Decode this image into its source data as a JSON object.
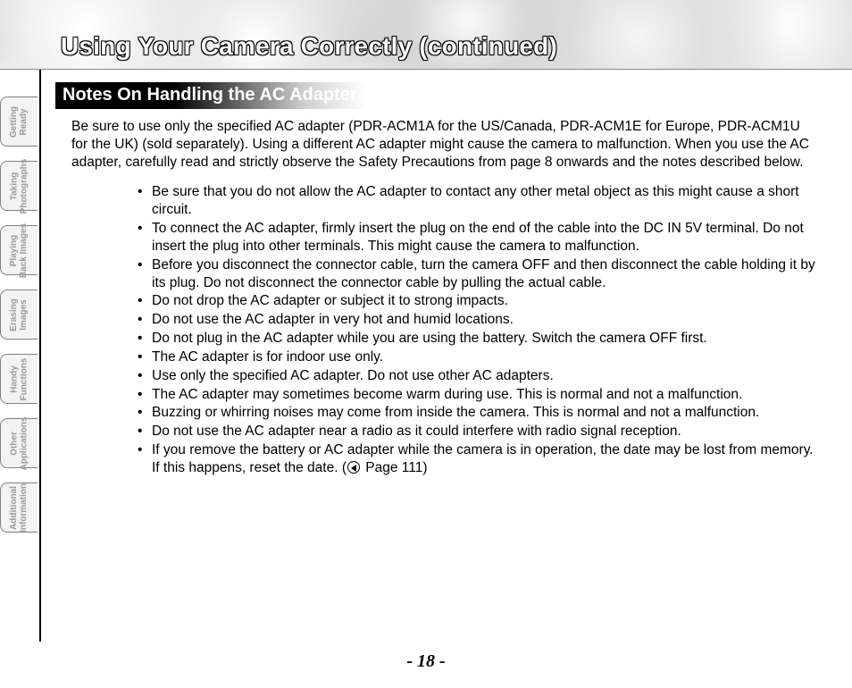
{
  "header": {
    "title": "Using Your Camera Correctly (continued)"
  },
  "sidebar": {
    "tabs": [
      {
        "label": "Getting\nReady"
      },
      {
        "label": "Taking\nPhotographs"
      },
      {
        "label": "Playing\nBack Images"
      },
      {
        "label": "Erasing\nImages"
      },
      {
        "label": "Handy\nFunctions"
      },
      {
        "label": "Other\nApplications"
      },
      {
        "label": "Additional\nInformation"
      }
    ]
  },
  "section": {
    "heading": "Notes On Handling the AC Adapter",
    "intro": "Be sure to use only the specified AC adapter (PDR-ACM1A for the US/Canada, PDR-ACM1E for Europe, PDR-ACM1U for the UK) (sold separately). Using a different AC adapter might cause the camera to malfunction. When you use the AC adapter, carefully read and strictly observe the Safety Precautions from page 8 onwards and the notes described below.",
    "bullets": [
      "Be sure that you do not allow the AC adapter to contact any other metal object as this might cause a short circuit.",
      "To connect the AC adapter, firmly insert the plug on the end of the cable into the DC IN 5V terminal. Do not insert the plug into other terminals. This might cause the camera to malfunction.",
      "Before you disconnect the connector cable, turn the camera OFF and then disconnect the cable holding it by its plug. Do not disconnect the connector cable by pulling the actual cable.",
      "Do not drop the AC adapter or subject it to strong impacts.",
      "Do not use the AC adapter in very hot and humid locations.",
      "Do not plug in the AC adapter while you are using the battery. Switch the camera OFF first.",
      "The AC adapter is for indoor use only.",
      "Use only the specified AC adapter. Do not use other AC adapters.",
      "The AC adapter may sometimes become warm during use. This is normal and not a malfunction.",
      "Buzzing or whirring noises may come from inside the camera. This is normal and not a malfunction.",
      "Do not use the AC adapter near a radio as it could interfere with radio signal reception."
    ],
    "bullet_last_before": "If you remove the battery or AC adapter while the camera is in operation, the date may be lost from memory. If this happens, reset the date. (",
    "bullet_last_after": " Page 111)"
  },
  "page_number": "- 18 -"
}
